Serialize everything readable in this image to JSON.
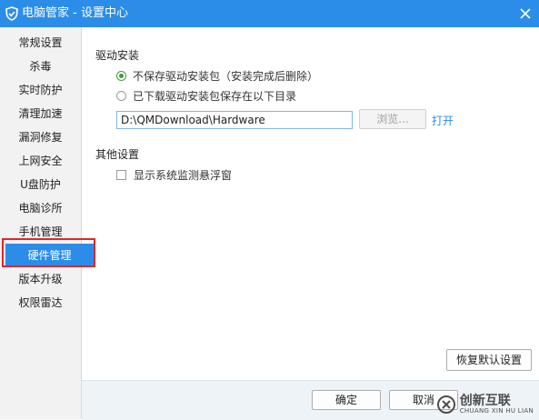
{
  "window": {
    "title": "电脑管家 - 设置中心",
    "accent_color": "#2c8de8",
    "icons": {
      "logo": "shield-logo-icon",
      "close": "close-icon"
    }
  },
  "sidebar": {
    "items": [
      {
        "label": "常规设置"
      },
      {
        "label": "杀毒"
      },
      {
        "label": "实时防护"
      },
      {
        "label": "清理加速"
      },
      {
        "label": "漏洞修复"
      },
      {
        "label": "上网安全"
      },
      {
        "label": "U盘防护"
      },
      {
        "label": "电脑诊所"
      },
      {
        "label": "手机管理"
      },
      {
        "label": "硬件管理",
        "active": true
      },
      {
        "label": "版本升级"
      },
      {
        "label": "权限雷达"
      }
    ]
  },
  "driver_install": {
    "section_title": "驱动安装",
    "option_no_save": "不保存驱动安装包（安装完成后删除）",
    "option_save_dir": "已下载驱动安装包保存在以下目录",
    "selected_option": "option_no_save",
    "path_value": "D:\\QMDownload\\Hardware",
    "browse_label": "浏览...",
    "open_label": "打开"
  },
  "other_settings": {
    "section_title": "其他设置",
    "floating_window_label": "显示系统监测悬浮窗",
    "floating_window_checked": false
  },
  "buttons": {
    "restore_defaults": "恢复默认设置",
    "ok": "确定",
    "cancel": "取消"
  },
  "watermark": {
    "text_cn": "创新互联",
    "text_en": "CHUANG XIN HU LIAN"
  }
}
